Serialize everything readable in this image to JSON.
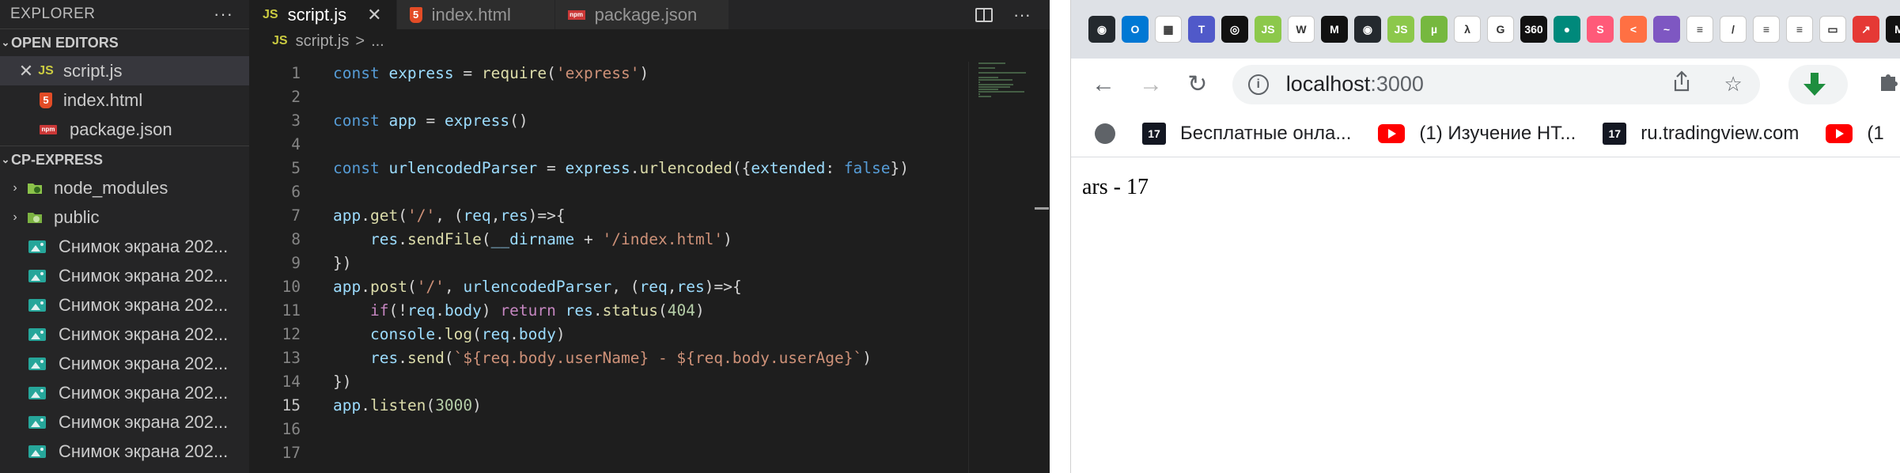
{
  "vscode": {
    "explorer_title": "EXPLORER",
    "more_icon": "ellipsis-icon",
    "open_editors_header": "OPEN EDITORS",
    "open_editors": [
      {
        "name": "script.js",
        "icon": "JS",
        "selected": true
      },
      {
        "name": "index.html",
        "icon": "5",
        "selected": false
      },
      {
        "name": "package.json",
        "icon": "npm",
        "selected": false
      }
    ],
    "project_header": "CP-EXPRESS",
    "folders": [
      {
        "name": "node_modules"
      },
      {
        "name": "public"
      }
    ],
    "files": [
      "Снимок экрана 202...",
      "Снимок экрана 202...",
      "Снимок экрана 202...",
      "Снимок экрана 202...",
      "Снимок экрана 202...",
      "Снимок экрана 202...",
      "Снимок экрана 202...",
      "Снимок экрана 202..."
    ],
    "tabs": [
      {
        "label": "script.js",
        "icon": "JS",
        "active": true
      },
      {
        "label": "index.html",
        "icon": "5",
        "active": false
      },
      {
        "label": "package.json",
        "icon": "npm",
        "active": false
      }
    ],
    "breadcrumb": {
      "icon": "JS",
      "file": "script.js",
      "sep": ">",
      "rest": "..."
    },
    "current_line": 15,
    "code_lines": [
      "const express = require('express')",
      "",
      "const app = express()",
      "",
      "const urlencodedParser = express.urlencoded({extended: false})",
      "",
      "app.get('/', (req,res)=>{",
      "    res.sendFile(__dirname + '/index.html')",
      "})",
      "app.post('/', urlencodedParser, (req,res)=>{",
      "    if(!req.body) return res.status(404)",
      "    console.log(req.body)",
      "    res.send(`${req.body.userName} - ${req.body.userAge}`)",
      "})",
      "app.listen(3000)",
      "",
      ""
    ]
  },
  "browser": {
    "extensions": [
      {
        "name": "github-icon",
        "color": "#24292e",
        "glyph": "◉"
      },
      {
        "name": "outlook-icon",
        "color": "#0078d4",
        "glyph": "O"
      },
      {
        "name": "qr-icon",
        "color": "#ffffff",
        "glyph": "▦"
      },
      {
        "name": "teams-icon",
        "color": "#5059c9",
        "glyph": "T"
      },
      {
        "name": "camera-icon",
        "color": "#111111",
        "glyph": "◎"
      },
      {
        "name": "nodejs-icon",
        "color": "#8cc84b",
        "glyph": "JS"
      },
      {
        "name": "w-icon",
        "color": "#ffffff",
        "glyph": "W"
      },
      {
        "name": "m-icon",
        "color": "#111111",
        "glyph": "M"
      },
      {
        "name": "github2-icon",
        "color": "#24292e",
        "glyph": "◉"
      },
      {
        "name": "nodejs2-icon",
        "color": "#8cc84b",
        "glyph": "JS"
      },
      {
        "name": "utorrent-icon",
        "color": "#76b83f",
        "glyph": "µ"
      },
      {
        "name": "figure-icon",
        "color": "#ffffff",
        "glyph": "λ"
      },
      {
        "name": "google-icon",
        "color": "#ffffff",
        "glyph": "G"
      },
      {
        "name": "efim-icon",
        "color": "#111111",
        "glyph": "360"
      },
      {
        "name": "teal-icon",
        "color": "#00897b",
        "glyph": "●"
      },
      {
        "name": "pink-icon",
        "color": "#ff5a79",
        "glyph": "S"
      },
      {
        "name": "orange-icon",
        "color": "#ff7043",
        "glyph": "<"
      },
      {
        "name": "wave-icon",
        "color": "#7e57c2",
        "glyph": "~"
      },
      {
        "name": "stack-icon",
        "color": "#ffffff",
        "glyph": "≡"
      },
      {
        "name": "pen-icon",
        "color": "#ffffff",
        "glyph": "/"
      },
      {
        "name": "stack2-icon",
        "color": "#ffffff",
        "glyph": "≡"
      },
      {
        "name": "stack3-icon",
        "color": "#ffffff",
        "glyph": "≡"
      },
      {
        "name": "screen-icon",
        "color": "#ffffff",
        "glyph": "▭"
      },
      {
        "name": "red-icon",
        "color": "#e53935",
        "glyph": "↗"
      },
      {
        "name": "m2-icon",
        "color": "#111111",
        "glyph": "M"
      }
    ],
    "nav": {
      "back": "←",
      "forward": "→",
      "reload": "↻"
    },
    "url": {
      "host": "localhost",
      "port": ":3000"
    },
    "omnibox_icons": {
      "share": "share-icon",
      "bookmark": "star-icon"
    },
    "bookmarks": [
      {
        "icon": "globe",
        "label": ""
      },
      {
        "icon": "tradingview",
        "label": "Бесплатные онла..."
      },
      {
        "icon": "youtube",
        "label": "(1) Изучение HT..."
      },
      {
        "icon": "tradingview",
        "label": "ru.tradingview.com"
      },
      {
        "icon": "youtube",
        "label": "(1"
      }
    ],
    "page_text": "ars - 17"
  }
}
